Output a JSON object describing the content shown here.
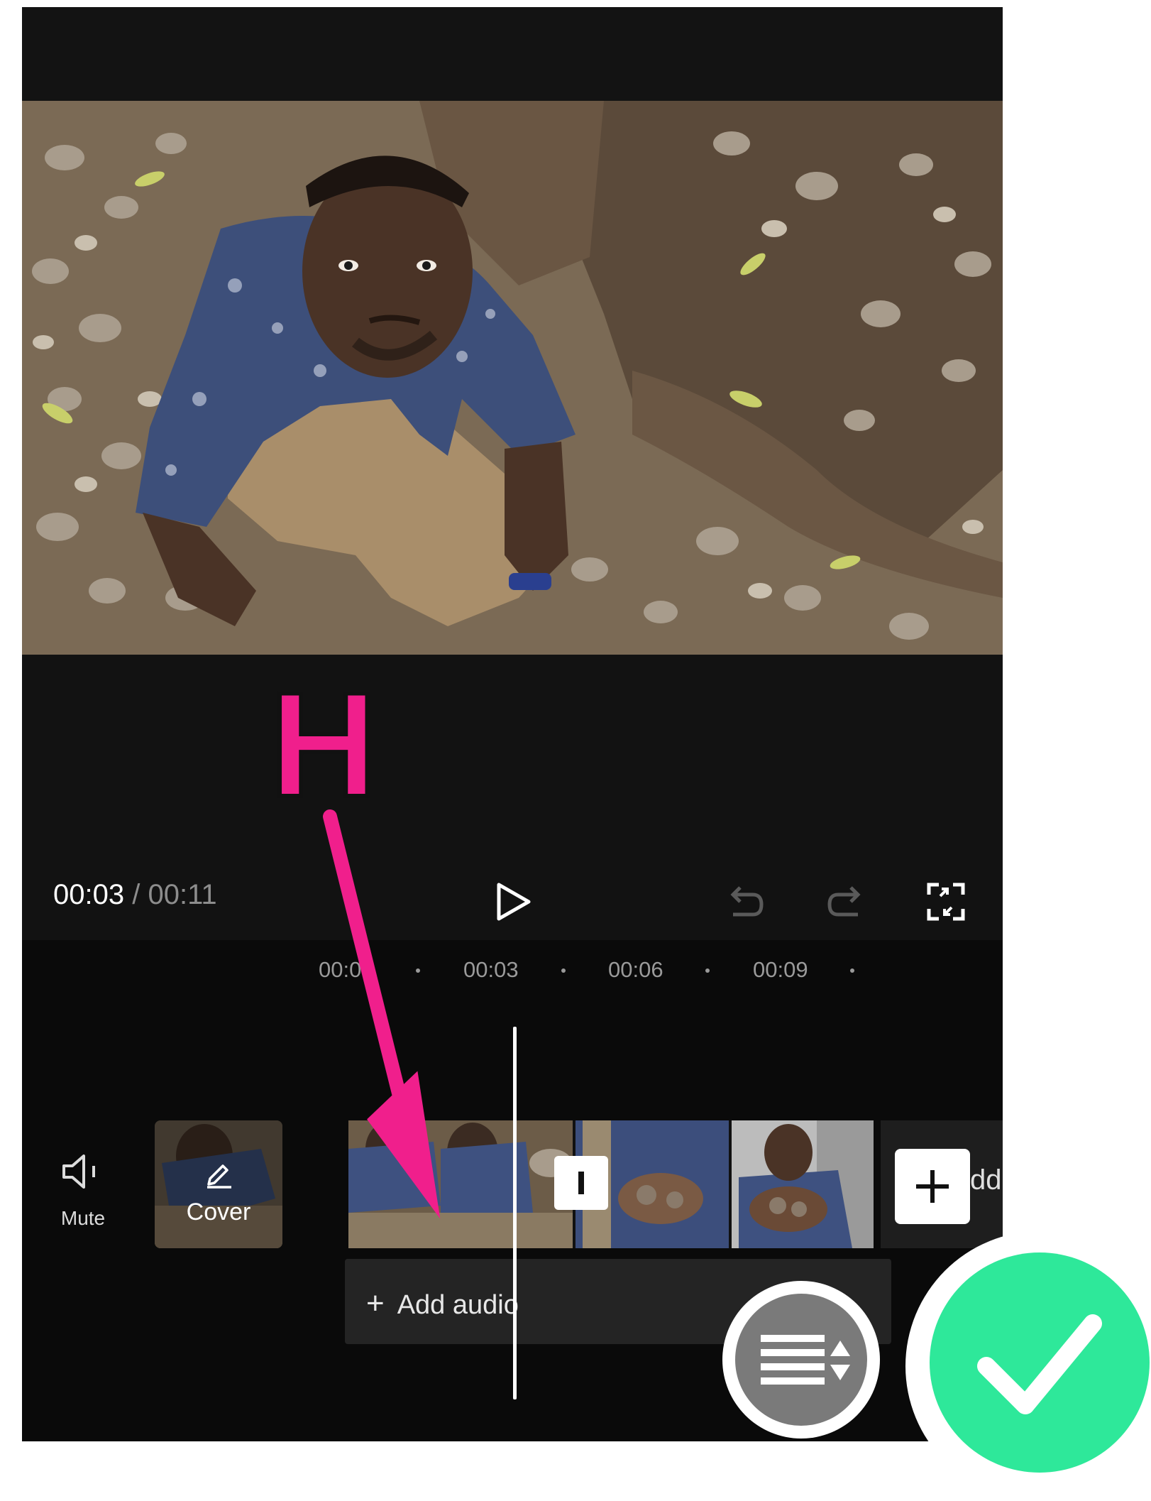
{
  "player": {
    "current_time": "00:03",
    "separator": "/",
    "total_time": "00:11"
  },
  "icons": {
    "play": "play-icon",
    "undo": "undo-icon",
    "redo": "redo-icon",
    "fullscreen": "fullscreen-icon",
    "mute": "speaker-icon",
    "cover_edit": "pencil-icon",
    "add_clip": "plus-icon",
    "split": "split-handle-icon",
    "menu_sort": "list-sort-icon",
    "confirm": "checkmark-icon"
  },
  "timeline": {
    "ticks": [
      "00:00",
      "00:03",
      "00:06",
      "00:09"
    ]
  },
  "tracks": {
    "mute_label": "Mute",
    "cover_label": "Cover",
    "add_audio_label": "Add audio",
    "add_clip_partial": "dd"
  },
  "annotation": {
    "letter": "H"
  },
  "colors": {
    "accent_pink": "#f01f8c",
    "confirm_green": "#2ee89a",
    "app_bg": "#0a0a0a",
    "menu_gray": "#7a7a7a"
  }
}
